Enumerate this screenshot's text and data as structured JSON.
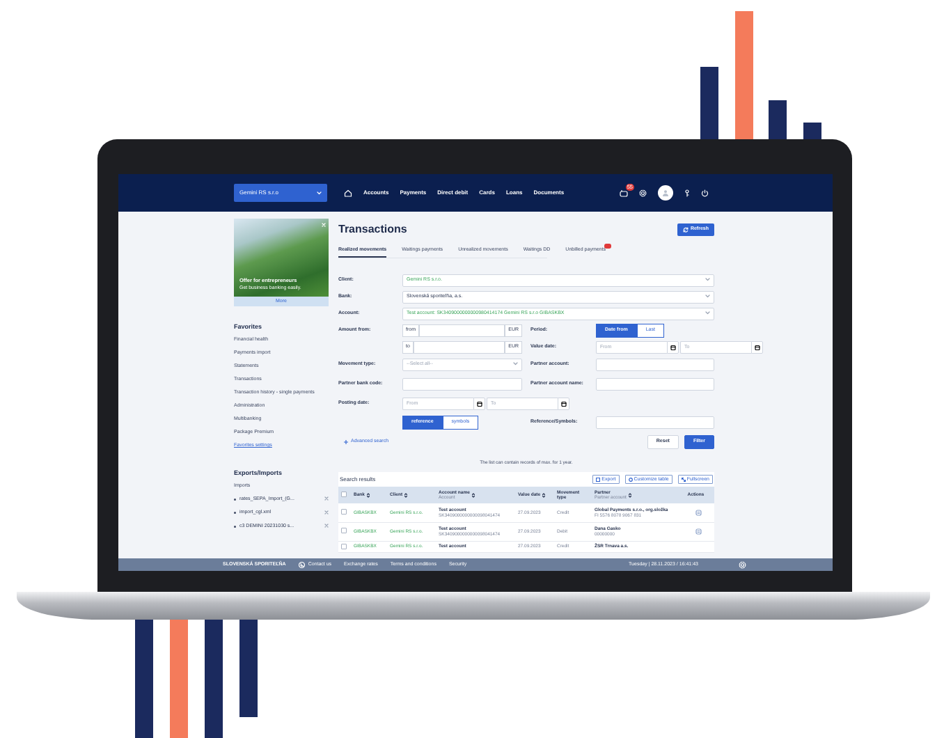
{
  "navbar": {
    "company_select": "Gemini RS s.r.o",
    "menu": [
      {
        "label": "Accounts"
      },
      {
        "label": "Payments"
      },
      {
        "label": "Direct debit"
      },
      {
        "label": "Cards"
      },
      {
        "label": "Loans"
      },
      {
        "label": "Documents"
      }
    ],
    "notification_badge": "55"
  },
  "promo": {
    "title": "Offer for entrepreneurs",
    "text": "Get business banking easily.",
    "button": "More"
  },
  "favorites": {
    "title": "Favorites",
    "items": [
      "Financial health",
      "Payments import",
      "Statements",
      "Transactions",
      "Transaction history - single payments",
      "Administration",
      "Multibanking",
      "Package Premium"
    ],
    "settings_link": "Favorites settings"
  },
  "exports_imports": {
    "title": "Exports/Imports",
    "subtitle": "Imports",
    "files": [
      "rates_SEPA_Import_(G...",
      "import_cgl.xml",
      "c3 DEMINI 20231030 s..."
    ]
  },
  "page": {
    "title": "Transactions",
    "refresh": "Refresh"
  },
  "tabs": [
    {
      "label": "Realized movements",
      "selected": true,
      "badge": false
    },
    {
      "label": "Waitings payments",
      "selected": false,
      "badge": false
    },
    {
      "label": "Unrealized movements",
      "selected": false,
      "badge": false
    },
    {
      "label": "Waitings DD",
      "selected": false,
      "badge": false
    },
    {
      "label": "Unbilled payments",
      "selected": false,
      "badge": true
    }
  ],
  "filters_full": [
    {
      "label": "Client:",
      "value": "Gemini RS s.r.o.",
      "accent": true
    },
    {
      "label": "Bank:",
      "value": "Slovenská sporiteľňa, a.s.",
      "accent": false
    },
    {
      "label": "Account:",
      "value": "Test account: SK3409000000000980414174 Gemini RS s.r.o GIBASKBX",
      "accent": true
    }
  ],
  "filter_rows": [
    {
      "left": {
        "kind": "amount",
        "label": "Amount from:",
        "prefix": "from",
        "currency": "EUR"
      },
      "right": {
        "kind": "toggle",
        "label": "Period:",
        "options": [
          {
            "label": "Date from",
            "selected": true
          },
          {
            "label": "Last",
            "selected": false
          }
        ]
      }
    },
    {
      "left": {
        "kind": "amount",
        "prefix": "to",
        "currency": "EUR"
      },
      "right": {
        "kind": "date_range",
        "label": "Value date:",
        "from_placeholder": "From",
        "to_placeholder": "To"
      }
    },
    {
      "left": {
        "kind": "select",
        "label": "Movement type:",
        "placeholder": "--Select all--"
      },
      "right": {
        "kind": "text",
        "label": "Partner account:"
      }
    },
    {
      "left": {
        "kind": "text",
        "label": "Partner bank code:"
      },
      "right": {
        "kind": "text",
        "label": "Partner account name:"
      }
    },
    {
      "left": {
        "kind": "date_range",
        "label": "Posting date:",
        "from_placeholder": "From",
        "to_placeholder": "To"
      }
    },
    {
      "left": {
        "kind": "toggle",
        "options": [
          {
            "label": "reference",
            "selected": true
          },
          {
            "label": "symbols",
            "selected": false
          }
        ]
      },
      "right": {
        "kind": "text",
        "label": "Reference/Symbols:"
      }
    }
  ],
  "advanced_search": "Advanced search",
  "form_buttons": {
    "reset": "Reset",
    "filter": "Filter"
  },
  "note": "The list can contain records of max. for 1 year.",
  "results": {
    "title": "Search results",
    "select_all_checked": false,
    "actions": [
      {
        "kind": "export",
        "label": "Export"
      },
      {
        "kind": "customize",
        "label": "Customize table"
      },
      {
        "kind": "fullscreen",
        "label": "Fullscreen"
      }
    ],
    "columns": [
      {
        "label": "Bank",
        "sortable": true
      },
      {
        "label": "Client",
        "sortable": true
      },
      {
        "label": "Account name",
        "sublabel": "Account",
        "sortable": true
      },
      {
        "label": "Value date",
        "sortable": true
      },
      {
        "label": "Movement type",
        "sortable": false
      },
      {
        "label": "Partner",
        "sublabel": "Partner account",
        "sortable": true
      },
      {
        "label": "Actions",
        "sortable": false
      }
    ],
    "rows": [
      {
        "checked": false,
        "bank": "GIBASKBX",
        "client": "Gemini RS s.r.o.",
        "account_name": "Test account",
        "account": "SK3409000000000098041474",
        "value_date": "27.09.2023",
        "movement_type": "Credit",
        "partner": "Global Payments s.r.o., org.složka",
        "partner_account": "FI 5576 8078 9067 831"
      },
      {
        "checked": false,
        "bank": "GIBASKBX",
        "client": "Gemini RS s.r.o.",
        "account_name": "Test account",
        "account": "SK3409000000000098041474",
        "value_date": "27.09.2023",
        "movement_type": "Debit",
        "partner": "Dana Gasko",
        "partner_account": "00000000"
      },
      {
        "checked": false,
        "bank": "GIBASKBX",
        "client": "Gemini RS s.r.o.",
        "account_name": "Test account",
        "value_date": "27.09.2023",
        "movement_type": "Credit",
        "partner": "ŽSR Trnava a.s."
      }
    ]
  },
  "footer": {
    "logo": "SLOVENSKÁ SPORITEĽŇA",
    "links": [
      "Contact us",
      "Exchange rates",
      "Terms and conditions",
      "Security"
    ],
    "datetime": "Tuesday | 28.11.2023 / 16:41:43"
  }
}
